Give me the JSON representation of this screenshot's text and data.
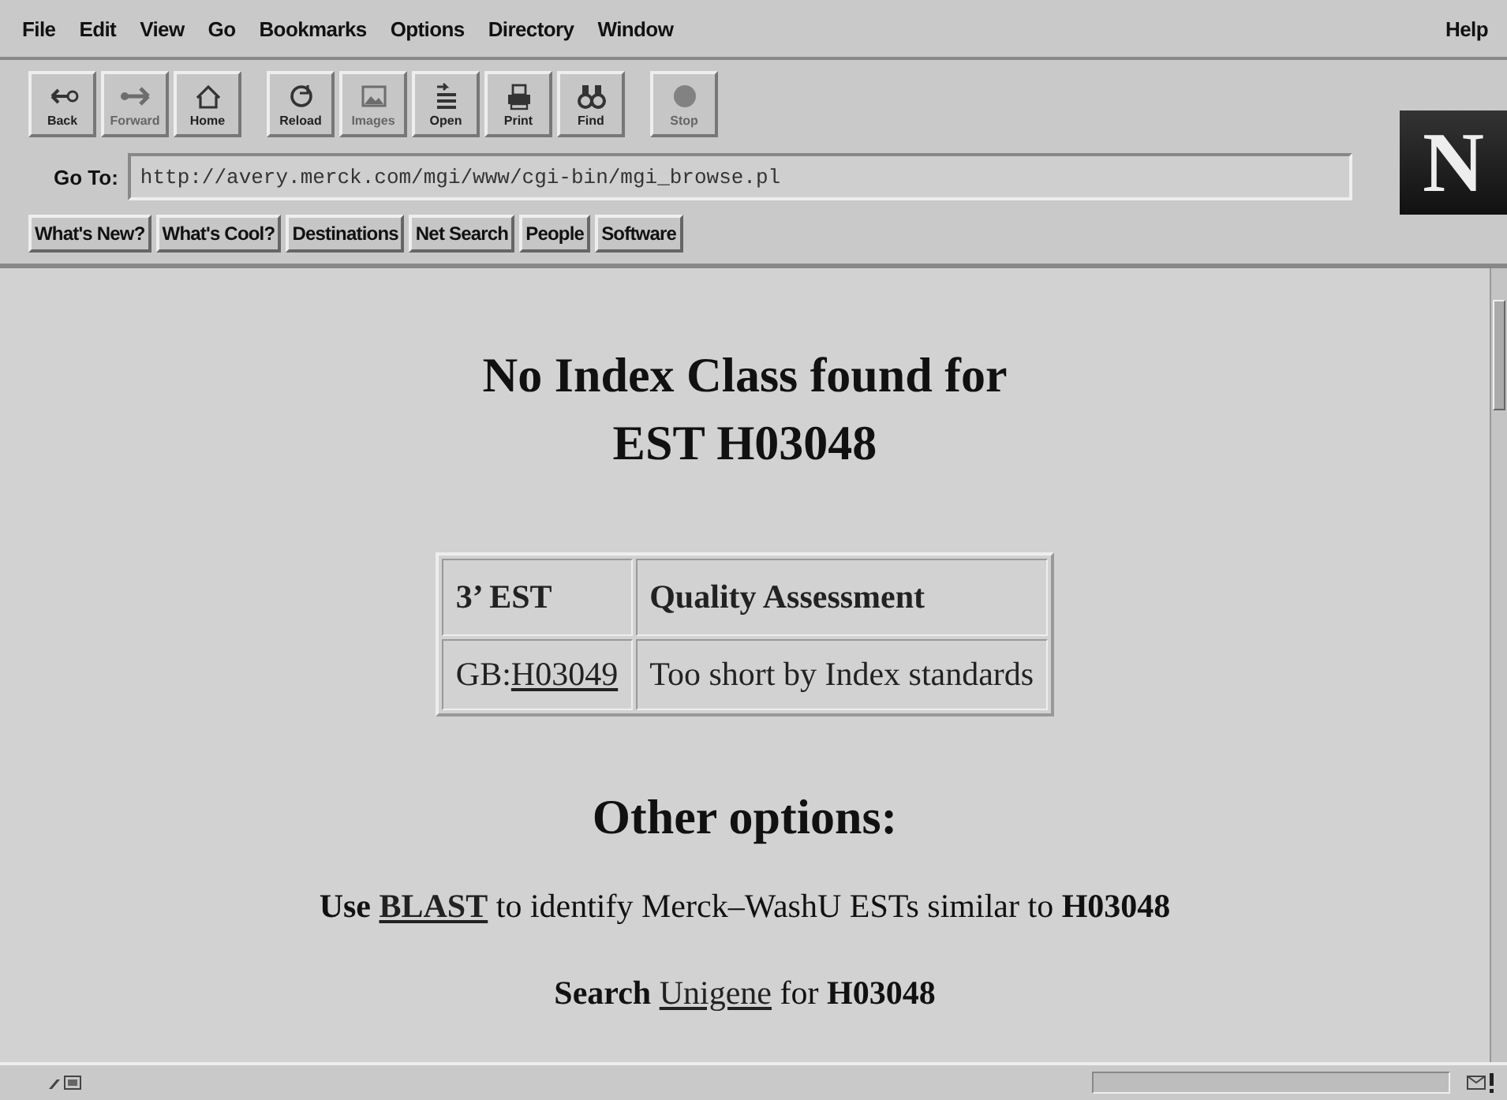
{
  "menu_bar": {
    "items": [
      "File",
      "Edit",
      "View",
      "Go",
      "Bookmarks",
      "Options",
      "Directory",
      "Window"
    ],
    "help": "Help"
  },
  "toolbar": [
    {
      "label": "Back",
      "disabled": false
    },
    {
      "label": "Forward",
      "disabled": true
    },
    {
      "label": "Home",
      "disabled": false
    },
    {
      "label": "Reload",
      "disabled": false
    },
    {
      "label": "Images",
      "disabled": true
    },
    {
      "label": "Open",
      "disabled": false
    },
    {
      "label": "Print",
      "disabled": false
    },
    {
      "label": "Find",
      "disabled": false
    },
    {
      "label": "Stop",
      "disabled": true
    }
  ],
  "location": {
    "label": "Go To:",
    "value": "http://avery.merck.com/mgi/www/cgi-bin/mgi_browse.pl"
  },
  "logo": "N",
  "directory_buttons": [
    "What's New?",
    "What's Cool?",
    "Destinations",
    "Net Search",
    "People",
    "Software"
  ],
  "page": {
    "heading": [
      "No Index Class found for",
      "EST H03048"
    ],
    "table": {
      "columns": [
        "3’ EST",
        "Quality Assessment"
      ],
      "rows": [
        {
          "prefix": "GB:",
          "link": "H03049",
          "assessment": "Too short by Index standards"
        }
      ]
    },
    "subheading": "Other options:",
    "options": [
      {
        "before": "**Use** ",
        "link": "BLAST",
        "link_bold": true,
        "after": " to identify Merck–WashU ESTs similar to **H03048**"
      },
      {
        "before": "**Search** ",
        "link": "Unigene",
        "link_bold": false,
        "after": " for **H03048**"
      }
    ]
  }
}
